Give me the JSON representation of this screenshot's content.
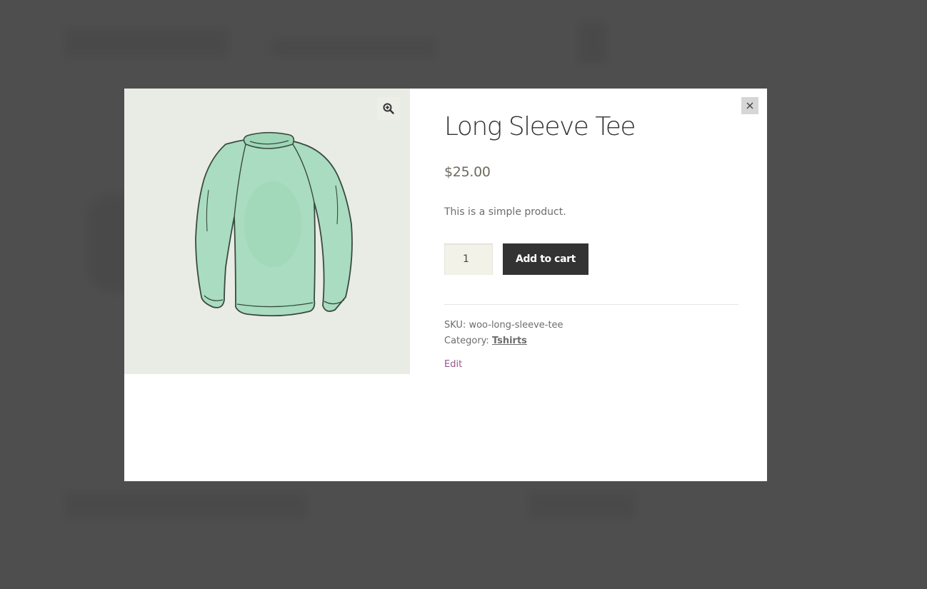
{
  "product": {
    "title": "Long Sleeve Tee",
    "price": "$25.00",
    "description": "This is a simple product.",
    "quantity": "1",
    "add_to_cart_label": "Add to cart",
    "sku_label": "SKU:",
    "sku_value": "woo-long-sleeve-tee",
    "category_label": "Category:",
    "category_value": "Tshirts",
    "edit_label": "Edit"
  },
  "icons": {
    "zoom": "zoom-in-icon",
    "close": "close-icon"
  },
  "colors": {
    "button_bg": "#333333",
    "price": "#6d6a5e",
    "edit_link": "#96588a",
    "gallery_bg": "#e9ebe5",
    "shirt_fill": "#a9dcc0"
  }
}
